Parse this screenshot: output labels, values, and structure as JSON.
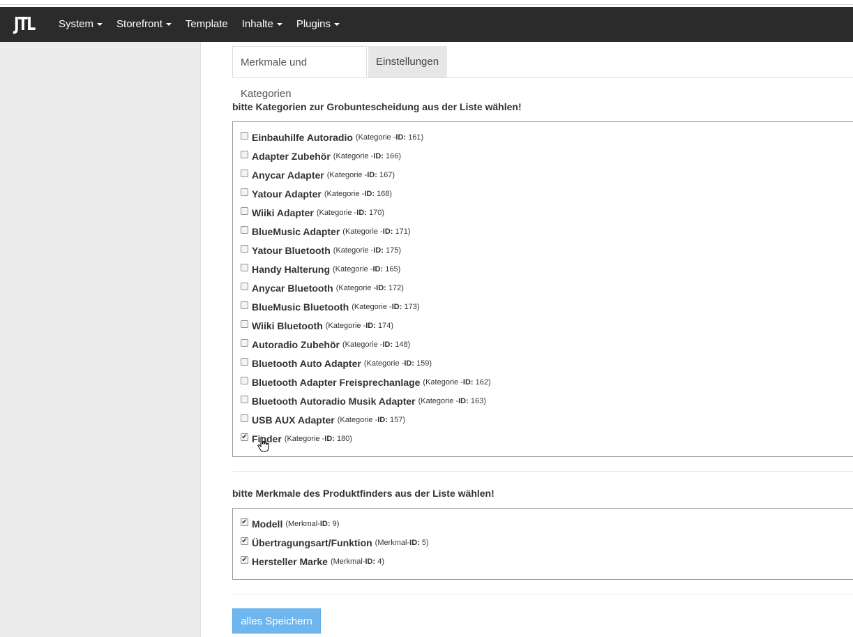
{
  "navbar": {
    "logo": "JTL",
    "items": [
      {
        "label": "System",
        "dropdown": true
      },
      {
        "label": "Storefront",
        "dropdown": true
      },
      {
        "label": "Template",
        "dropdown": false
      },
      {
        "label": "Inhalte",
        "dropdown": true
      },
      {
        "label": "Plugins",
        "dropdown": true
      }
    ]
  },
  "tabs": [
    {
      "label": "Merkmale und Kategorien",
      "active": true
    },
    {
      "label": "Einstellungen",
      "active": false
    }
  ],
  "categories_section": {
    "title": "bitte Kategorien zur Grobuntescheidung aus der Liste wählen!",
    "id_prefix": "(Kategorie -",
    "id_key": "ID:",
    "items": [
      {
        "name": "Einbauhilfe Autoradio",
        "id": "161",
        "checked": false
      },
      {
        "name": "Adapter Zubehör",
        "id": "166",
        "checked": false
      },
      {
        "name": "Anycar Adapter",
        "id": "167",
        "checked": false
      },
      {
        "name": "Yatour Adapter",
        "id": "168",
        "checked": false
      },
      {
        "name": "Wiiki Adapter",
        "id": "170",
        "checked": false
      },
      {
        "name": "BlueMusic Adapter",
        "id": "171",
        "checked": false
      },
      {
        "name": "Yatour Bluetooth",
        "id": "175",
        "checked": false
      },
      {
        "name": "Handy Halterung",
        "id": "165",
        "checked": false
      },
      {
        "name": "Anycar Bluetooth",
        "id": "172",
        "checked": false
      },
      {
        "name": "BlueMusic Bluetooth",
        "id": "173",
        "checked": false
      },
      {
        "name": "Wiiki Bluetooth",
        "id": "174",
        "checked": false
      },
      {
        "name": "Autoradio Zubehör",
        "id": "148",
        "checked": false
      },
      {
        "name": "Bluetooth Auto Adapter",
        "id": "159",
        "checked": false
      },
      {
        "name": "Bluetooth Adapter Freisprechanlage",
        "id": "162",
        "checked": false
      },
      {
        "name": "Bluetooth Autoradio Musik Adapter",
        "id": "163",
        "checked": false
      },
      {
        "name": "USB AUX Adapter",
        "id": "157",
        "checked": false
      },
      {
        "name": "Finder",
        "id": "180",
        "checked": true
      }
    ]
  },
  "features_section": {
    "title": "bitte Merkmale des Produktfinders aus der Liste wählen!",
    "id_prefix": "(Merkmal-",
    "id_key": "ID:",
    "items": [
      {
        "name": "Modell",
        "id": "9",
        "checked": true
      },
      {
        "name": "Übertragungsart/Funktion",
        "id": "5",
        "checked": true
      },
      {
        "name": "Hersteller Marke",
        "id": "4",
        "checked": true
      }
    ]
  },
  "save_button": {
    "label": "alles Speichern"
  },
  "colors": {
    "navbar_bg": "#2b2b2b",
    "sidebar_bg": "#ececec",
    "button_bg": "#6fb6ee"
  }
}
